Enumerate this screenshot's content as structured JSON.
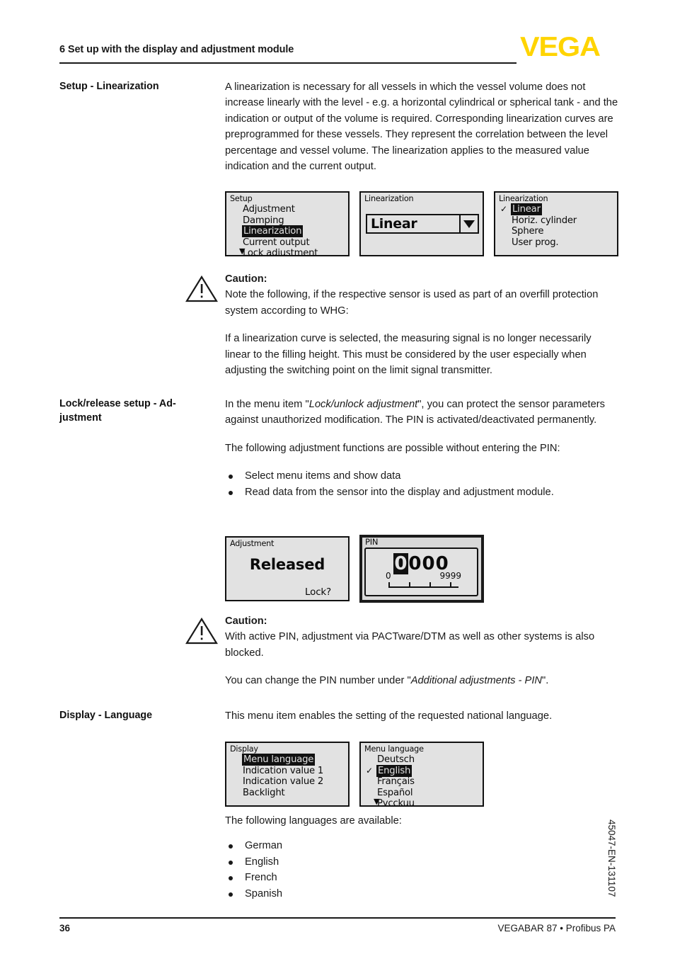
{
  "header": {
    "chapter_title": "6 Set up with the display and adjustment module",
    "logo_text": "VEGA",
    "logo_color": "#FFD400"
  },
  "sections": [
    {
      "heading": "Setup - Linearization",
      "paragraphs": [
        "A linearization is necessary for all vessels in which the vessel volume does not increase linearly with the level - e.g. a horizontal cylindrical or spherical tank - and the indication or output of the volume is required. Corresponding linearization curves are preprogrammed for these vessels. They represent the correlation between the level percentage and vessel volume. The linearization applies to the measured value indication and the current output."
      ]
    },
    {
      "heading_line1": "Lock/release setup - Ad-",
      "heading_line2": "justment",
      "heading": "Lock/release setup - Adjustment",
      "para1_pre": "In the menu item \"",
      "para1_italic": "Lock/unlock adjustment",
      "para1_post": "\", you can protect the sensor parameters against unauthorized modification. The PIN is activated/deactivated permanently.",
      "para2": "The following adjustment functions are possible without entering the PIN:",
      "bullets": [
        "Select menu items and show data",
        "Read data from the sensor into the display and adjustment module."
      ]
    },
    {
      "heading": "Display - Language",
      "para1": "This menu item enables the setting of the requested national language.",
      "para2": "The following languages are available:",
      "bullets": [
        "German",
        "English",
        "French",
        "Spanish"
      ]
    }
  ],
  "cautions": [
    {
      "title": "Caution:",
      "para1": "Note the following, if the respective sensor is used as part of an overfill protection system according to WHG:",
      "para2": "If a linearization curve is selected, the measuring signal is no longer necessarily linear to the filling height. This must be considered by the user especially when adjusting the switching point on the limit signal transmitter."
    },
    {
      "title": "Caution:",
      "para1": "With active PIN, adjustment via PACTware/DTM as well as other systems is also blocked.",
      "para2_pre": "You can change the PIN number under \"",
      "para2_italic": "Additional adjustments - PIN",
      "para2_post": "\"."
    }
  ],
  "lcd_screens": {
    "setup_menu": {
      "title": "Setup",
      "items": [
        {
          "label": "Adjustment",
          "selected": false,
          "checked": false
        },
        {
          "label": "Damping",
          "selected": false,
          "checked": false
        },
        {
          "label": "Linearization",
          "selected": true,
          "checked": false
        },
        {
          "label": "Current output",
          "selected": false,
          "checked": false
        },
        {
          "label": "Lock adjustment",
          "selected": false,
          "checked": false
        }
      ],
      "more_indicator": "▼"
    },
    "linearization_combo": {
      "title": "Linearization",
      "value": "Linear"
    },
    "linearization_list": {
      "title": "Linearization",
      "items": [
        {
          "label": "Linear",
          "selected": true,
          "checked": true
        },
        {
          "label": "Horiz. cylinder",
          "selected": false,
          "checked": false
        },
        {
          "label": "Sphere",
          "selected": false,
          "checked": false
        },
        {
          "label": "User prog.",
          "selected": false,
          "checked": false
        }
      ]
    },
    "adjustment_status": {
      "title": "Adjustment",
      "value": "Released",
      "action": "Lock?"
    },
    "pin_entry": {
      "title": "PIN",
      "digit_active": "0",
      "digits_rest": "000",
      "scale_min": "0",
      "scale_max": "9999"
    },
    "display_menu": {
      "title": "Display",
      "items": [
        {
          "label": "Menu language",
          "selected": true,
          "checked": false
        },
        {
          "label": "Indication value 1",
          "selected": false,
          "checked": false
        },
        {
          "label": "Indication value 2",
          "selected": false,
          "checked": false
        },
        {
          "label": "Backlight",
          "selected": false,
          "checked": false
        }
      ]
    },
    "menu_language": {
      "title": "Menu language",
      "items": [
        {
          "label": "Deutsch",
          "selected": false,
          "checked": false
        },
        {
          "label": "English",
          "selected": true,
          "checked": true
        },
        {
          "label": "Français",
          "selected": false,
          "checked": false
        },
        {
          "label": "Español",
          "selected": false,
          "checked": false
        },
        {
          "label": "Pуcckuu",
          "selected": false,
          "checked": false
        }
      ],
      "more_indicator": "▼"
    }
  },
  "footer": {
    "page_number": "36",
    "product": "VEGABAR 87 • Profibus PA",
    "document_code": "45047-EN-131107"
  }
}
